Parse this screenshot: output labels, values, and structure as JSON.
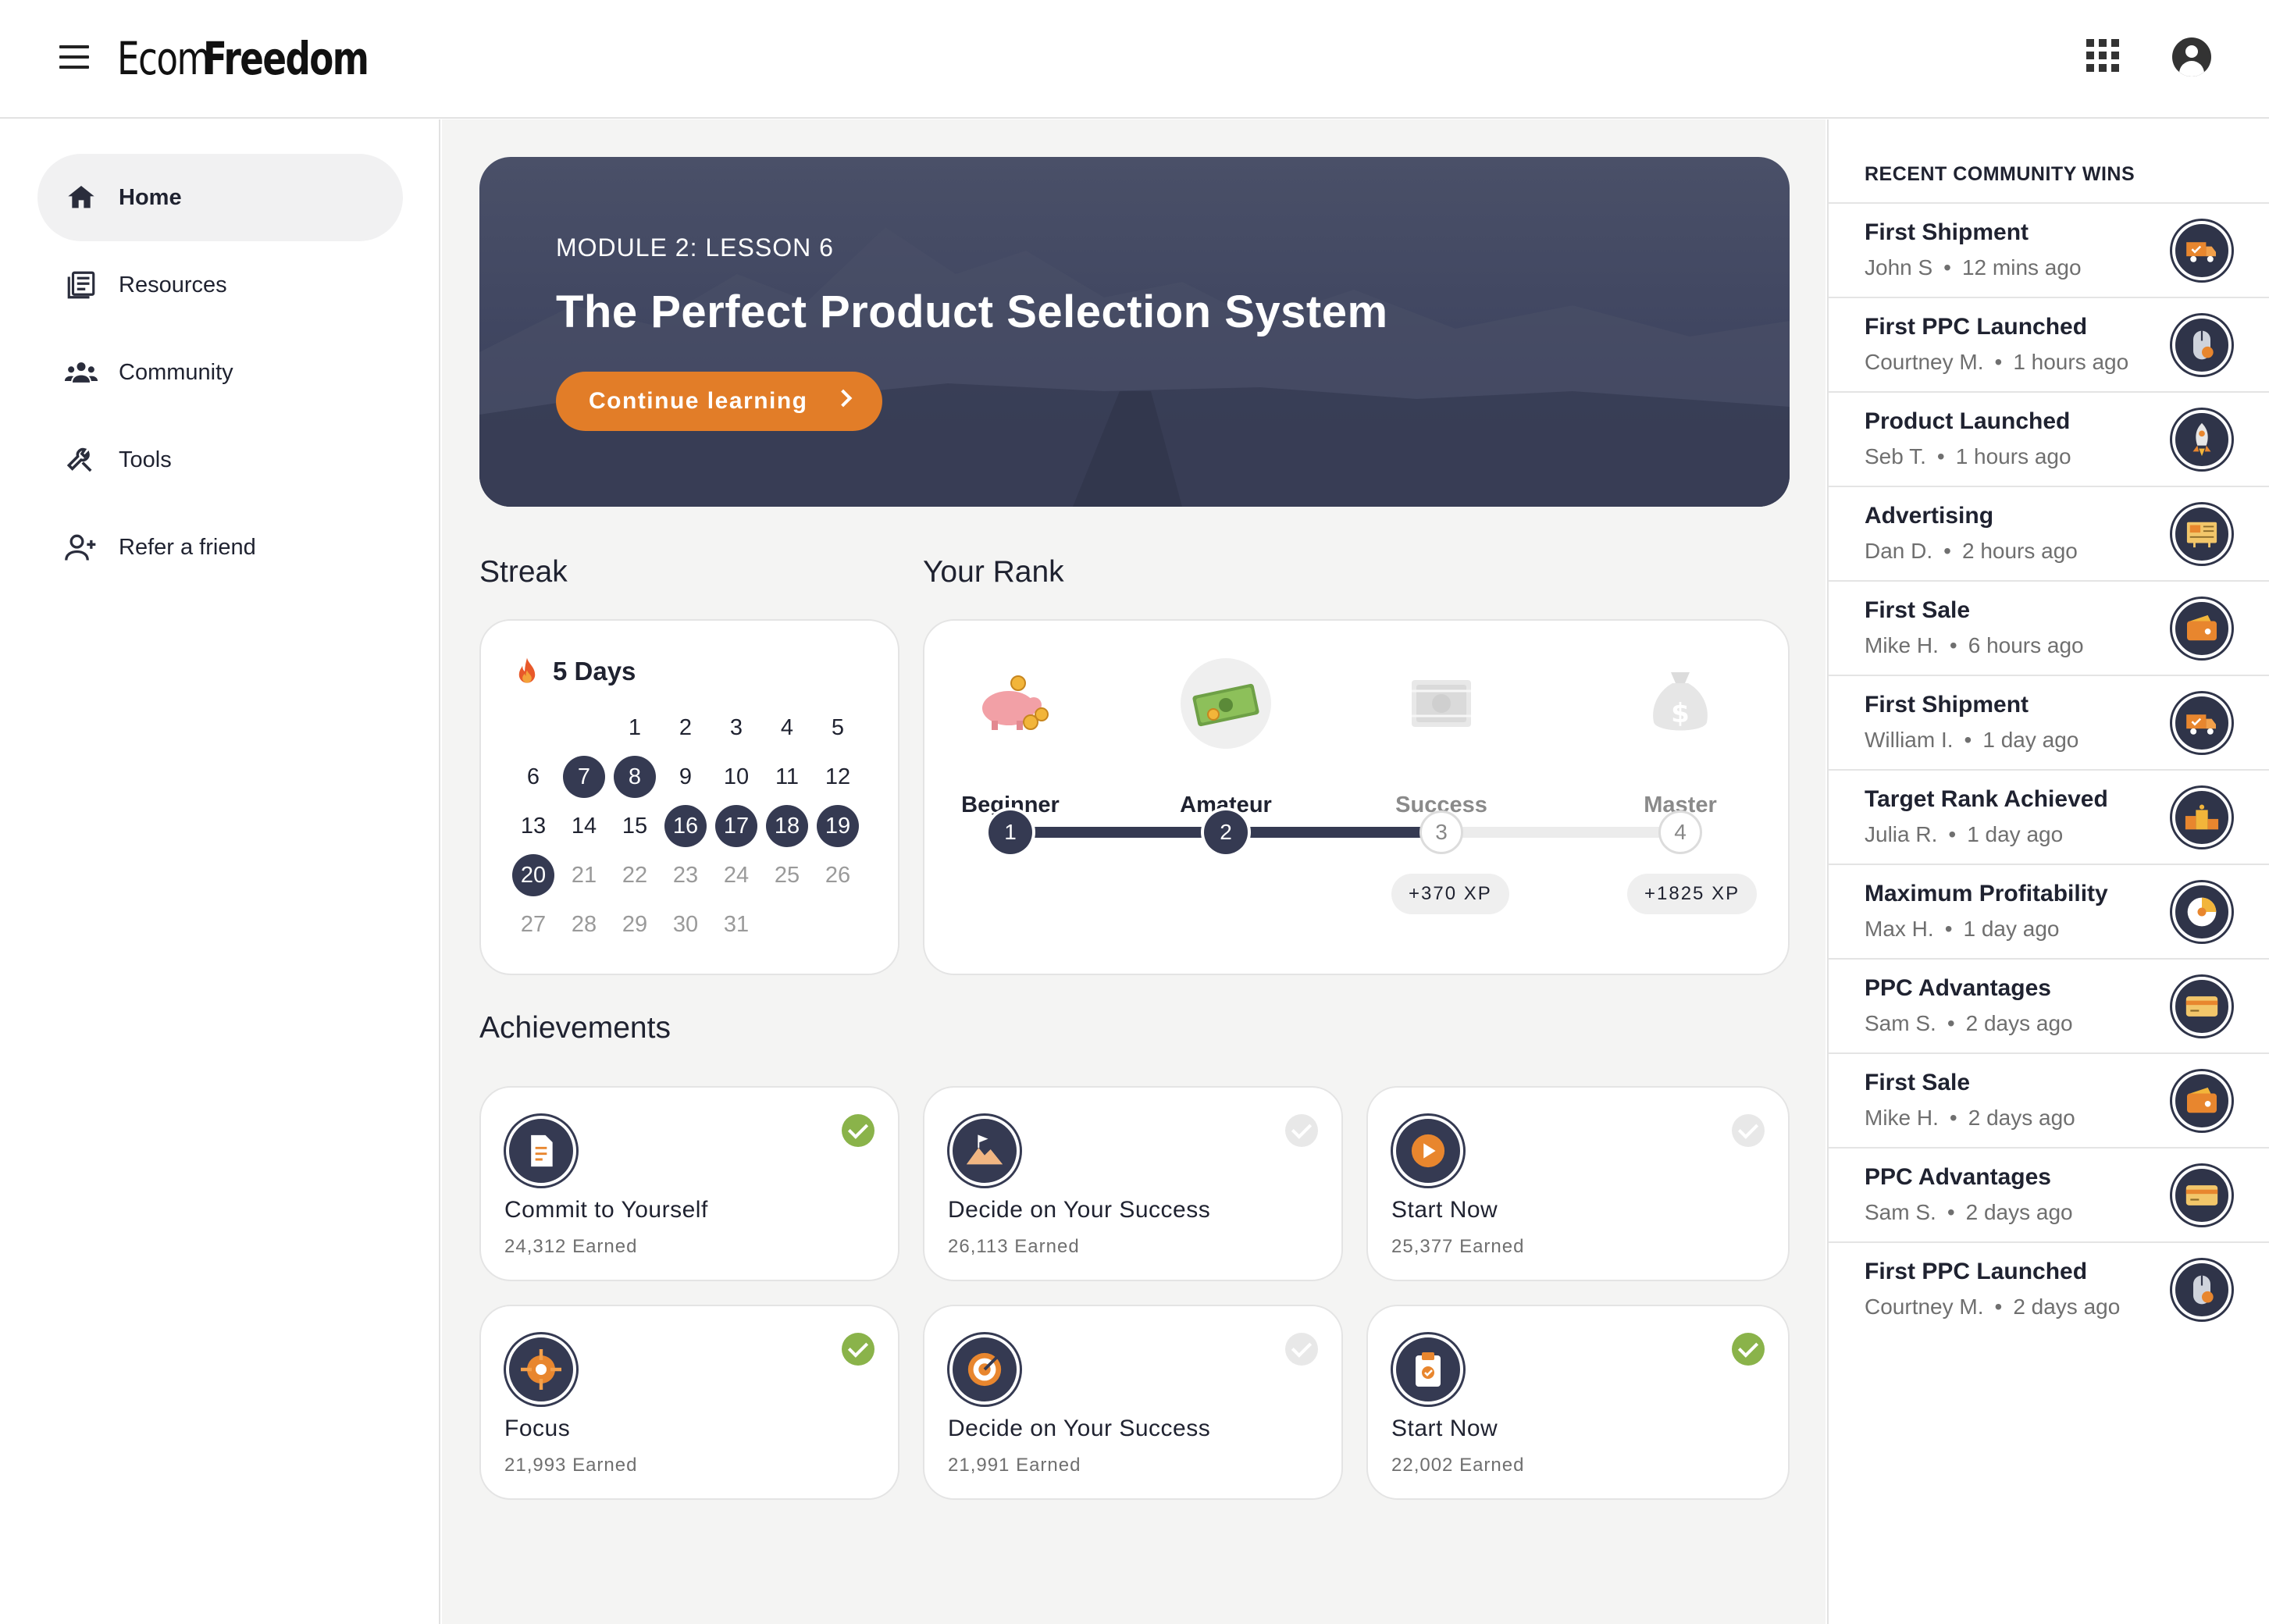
{
  "header": {
    "logo_part1": "Ecom",
    "logo_part2": "Freedom"
  },
  "sidebar": {
    "items": [
      {
        "label": "Home",
        "icon": "home-icon",
        "active": true
      },
      {
        "label": "Resources",
        "icon": "resources-icon",
        "active": false
      },
      {
        "label": "Community",
        "icon": "community-icon",
        "active": false
      },
      {
        "label": "Tools",
        "icon": "wrench-icon",
        "active": false
      },
      {
        "label": "Refer a friend",
        "icon": "add-person-icon",
        "active": false
      }
    ]
  },
  "hero": {
    "module": "MODULE 2: LESSON 6",
    "title": "The Perfect Product Selection System",
    "cta": "Continue learning"
  },
  "streak": {
    "section_title": "Streak",
    "days_label": "5 Days",
    "weeks": [
      [
        "",
        "",
        "1",
        "2",
        "3",
        "4",
        "5"
      ],
      [
        "6",
        "7",
        "8",
        "9",
        "10",
        "11",
        "12"
      ],
      [
        "13",
        "14",
        "15",
        "16",
        "17",
        "18",
        "19"
      ],
      [
        "20",
        "21",
        "22",
        "23",
        "24",
        "25",
        "26"
      ],
      [
        "27",
        "28",
        "29",
        "30",
        "31",
        "",
        ""
      ]
    ],
    "filled_days": [
      "7",
      "8",
      "16",
      "17",
      "18",
      "19",
      "20"
    ],
    "muted_from": 21
  },
  "rank": {
    "section_title": "Your Rank",
    "levels": [
      {
        "name": "Beginner",
        "step": "1",
        "done": true,
        "icon": "piggy-bank-icon"
      },
      {
        "name": "Amateur",
        "step": "2",
        "done": true,
        "icon": "cash-icon"
      },
      {
        "name": "Success",
        "step": "3",
        "done": false,
        "icon": "money-stack-icon",
        "xp": "+370 XP"
      },
      {
        "name": "Master",
        "step": "4",
        "done": false,
        "icon": "money-bag-icon",
        "xp": "+1825 XP"
      }
    ]
  },
  "achievements": {
    "section_title": "Achievements",
    "items": [
      {
        "name": "Commit to Yourself",
        "earned": "24,312 Earned",
        "achieved": true,
        "icon": "document-icon"
      },
      {
        "name": "Decide on Your Success",
        "earned": "26,113 Earned",
        "achieved": false,
        "icon": "mountain-flag-icon"
      },
      {
        "name": "Start Now",
        "earned": "25,377 Earned",
        "achieved": false,
        "icon": "play-icon"
      },
      {
        "name": "Focus",
        "earned": "21,993 Earned",
        "achieved": true,
        "icon": "crosshair-icon"
      },
      {
        "name": "Decide on Your Success",
        "earned": "21,991 Earned",
        "achieved": false,
        "icon": "target-icon"
      },
      {
        "name": "Start Now",
        "earned": "22,002 Earned",
        "achieved": true,
        "icon": "clipboard-icon"
      }
    ]
  },
  "community_wins": {
    "title": "RECENT COMMUNITY WINS",
    "items": [
      {
        "title": "First Shipment",
        "user": "John S",
        "time": "12 mins ago",
        "icon": "truck-icon"
      },
      {
        "title": "First PPC Launched",
        "user": "Courtney M.",
        "time": "1 hours ago",
        "icon": "mouse-icon"
      },
      {
        "title": "Product Launched",
        "user": "Seb T.",
        "time": "1 hours ago",
        "icon": "rocket-icon"
      },
      {
        "title": "Advertising",
        "user": "Dan D.",
        "time": "2 hours ago",
        "icon": "billboard-icon"
      },
      {
        "title": "First Sale",
        "user": "Mike H.",
        "time": "6 hours ago",
        "icon": "wallet-icon"
      },
      {
        "title": "First Shipment",
        "user": "William I.",
        "time": "1 day ago",
        "icon": "truck-icon"
      },
      {
        "title": "Target Rank Achieved",
        "user": "Julia R.",
        "time": "1 day ago",
        "icon": "podium-icon"
      },
      {
        "title": "Maximum Profitability",
        "user": "Max H.",
        "time": "1 day ago",
        "icon": "gauge-icon"
      },
      {
        "title": "PPC Advantages",
        "user": "Sam S.",
        "time": "2 days ago",
        "icon": "credit-card-icon"
      },
      {
        "title": "First Sale",
        "user": "Mike H.",
        "time": "2 days ago",
        "icon": "wallet-icon"
      },
      {
        "title": "PPC Advantages",
        "user": "Sam S.",
        "time": "2 days ago",
        "icon": "credit-card-icon"
      },
      {
        "title": "First PPC Launched",
        "user": "Courtney M.",
        "time": "2 days ago",
        "icon": "mouse-icon"
      }
    ]
  },
  "colors": {
    "accent": "#e27d28",
    "navy": "#353a52",
    "success": "#8ab34a"
  }
}
